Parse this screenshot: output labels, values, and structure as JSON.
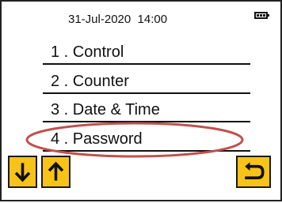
{
  "status": {
    "datetime": "31-Jul-2020  14:00",
    "battery_icon": "battery-full-icon"
  },
  "menu": {
    "items": [
      {
        "label": "1 . Control"
      },
      {
        "label": "2 . Counter"
      },
      {
        "label": "3 . Date & Time"
      },
      {
        "label": "4 . Password"
      }
    ]
  },
  "highlight": {
    "target_index": 3,
    "color": "#c0504d"
  },
  "buttons": {
    "down_icon": "arrow-down-icon",
    "up_icon": "arrow-up-icon",
    "back_icon": "back-return-icon",
    "color": "#f7c316"
  }
}
